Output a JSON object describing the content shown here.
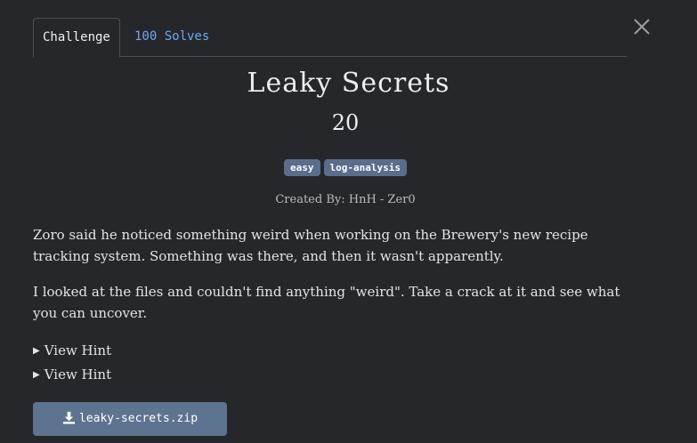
{
  "tabs": {
    "challenge": "Challenge",
    "solves": "100 Solves"
  },
  "challenge": {
    "title": "Leaky Secrets",
    "points": "20",
    "tags": [
      "easy",
      "log-analysis"
    ],
    "author": "Created By: HnH - Zer0",
    "description": [
      "Zoro said he noticed something weird when working on the Brewery's new recipe tracking system. Something was there, and then it wasn't apparently.",
      "I looked at the files and couldn't find anything \"weird\". Take a crack at it and see what you can uncover."
    ],
    "hints": [
      "View Hint",
      "View Hint"
    ],
    "download": "leaky-secrets.zip"
  },
  "icons": {
    "close": "close-icon",
    "download": "download-icon",
    "hint_arrow": "triangle-right-icon"
  },
  "colors": {
    "background": "#25272b",
    "tag": "#5a6d8c",
    "button": "#5e7390",
    "link": "#6ea8f0"
  }
}
